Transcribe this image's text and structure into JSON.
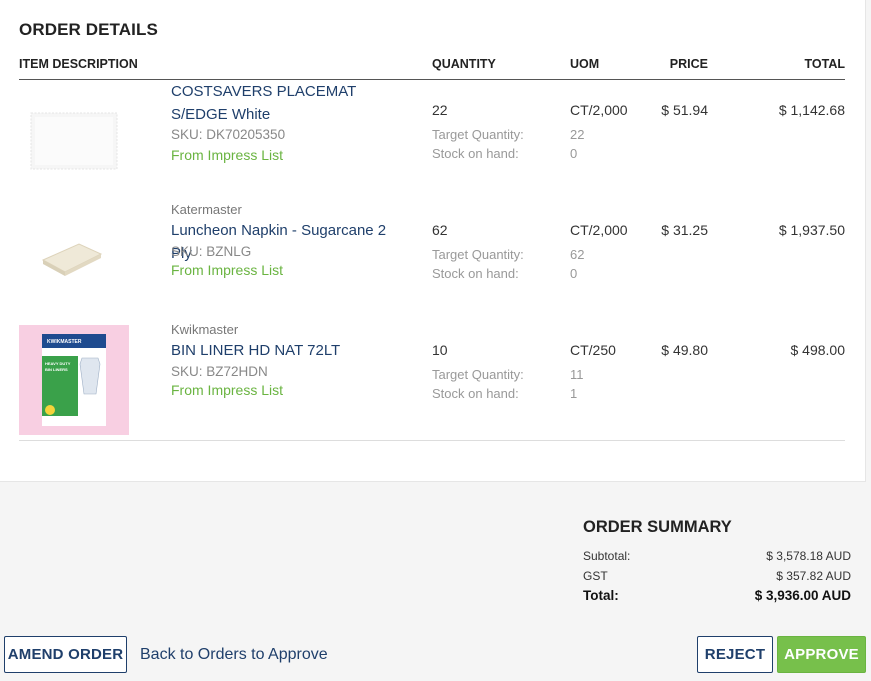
{
  "order_details": {
    "title": "ORDER DETAILS",
    "columns": {
      "item_description": "ITEM DESCRIPTION",
      "quantity": "QUANTITY",
      "uom": "UOM",
      "price": "PRICE",
      "total": "TOTAL"
    },
    "target_label": "Target Quantity:",
    "stock_label": "Stock on hand:",
    "items": [
      {
        "brand": "",
        "name": "COSTSAVERS PLACEMAT S/EDGE White",
        "sku": "SKU: DK70205350",
        "source": "From Impress List",
        "quantity": "22",
        "target_quantity": "22",
        "stock_on_hand": "0",
        "uom": "CT/2,000",
        "price": "$ 51.94",
        "total": "$ 1,142.68",
        "image": "placemat-image"
      },
      {
        "brand": "Katermaster",
        "name": "Luncheon Napkin - Sugarcane 2 Ply",
        "sku": "SKU: BZNLG",
        "source": "From Impress List",
        "quantity": "62",
        "target_quantity": "62",
        "stock_on_hand": "0",
        "uom": "CT/2,000",
        "price": "$ 31.25",
        "total": "$ 1,937.50",
        "image": "napkin-image"
      },
      {
        "brand": "Kwikmaster",
        "name": "BIN LINER HD NAT 72LT",
        "sku": "SKU: BZ72HDN",
        "source": "From Impress List",
        "quantity": "10",
        "target_quantity": "11",
        "stock_on_hand": "1",
        "uom": "CT/250",
        "price": "$ 49.80",
        "total": "$ 498.00",
        "image": "bin-liner-box-image",
        "package_text": {
          "logo": "KWIKMASTER",
          "line1": "HEAVY DUTY",
          "line2": "BIN LINERS"
        }
      }
    ]
  },
  "order_summary": {
    "title": "ORDER SUMMARY",
    "subtotal_label": "Subtotal:",
    "subtotal": "$ 3,578.18 AUD",
    "gst_label": "GST",
    "gst": "$ 357.82 AUD",
    "total_label": "Total:",
    "total": "$ 3,936.00 AUD"
  },
  "actions": {
    "amend": "AMEND ORDER",
    "back": "Back to Orders to Approve",
    "reject": "REJECT",
    "approve": "APPROVE"
  },
  "colors": {
    "brand_navy": "#1f3f6b",
    "accent_green": "#77c04b",
    "impress_green": "#6ab441"
  }
}
